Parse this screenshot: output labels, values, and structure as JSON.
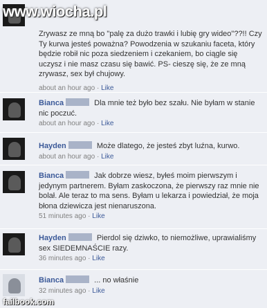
{
  "watermark": {
    "top": "www.wiocha.pl",
    "bottom": "failbook.com"
  },
  "comments": [
    {
      "author": "",
      "text": "Zrywasz ze mną bo \"palę za dużo trawki i lubię gry wideo\"??!! Czy Ty kurwa jesteś poważna? Powodzenia w szukaniu faceta, który będzie robił nic poza siedzeniem i czekaniem, bo ciągle się uczysz i nie masz czasu się bawić. PS- cieszę się, że ze mną zrywasz, sex był chujowy.",
      "time": "about an hour ago",
      "like": "Like"
    },
    {
      "author": "Bianca",
      "text": "Dla mnie też było bez szału. Nie byłam w stanie nic poczuć.",
      "time": "about an hour ago",
      "like": "Like"
    },
    {
      "author": "Hayden",
      "text": "Może dlatego, że jesteś zbyt luźna, kurwo.",
      "time": "about an hour ago",
      "like": "Like"
    },
    {
      "author": "Bianca",
      "text": "Jak dobrze wiesz, byłeś moim pierwszym i jedynym partnerem. Byłam zaskoczona, że pierwszy raz mnie nie bolał. Ale teraz to ma sens. Byłam u lekarza i powiedział, że moja błona dziewicza jest nienaruszona.",
      "time": "51 minutes ago",
      "like": "Like"
    },
    {
      "author": "Hayden",
      "text": "Pierdol się dziwko, to niemożliwe, uprawialiśmy sex SIEDEMNAŚCIE razy.",
      "time": "36 minutes ago",
      "like": "Like"
    },
    {
      "author": "Bianca",
      "text": "... no właśnie",
      "time": "32 minutes ago",
      "like": "Like"
    }
  ]
}
